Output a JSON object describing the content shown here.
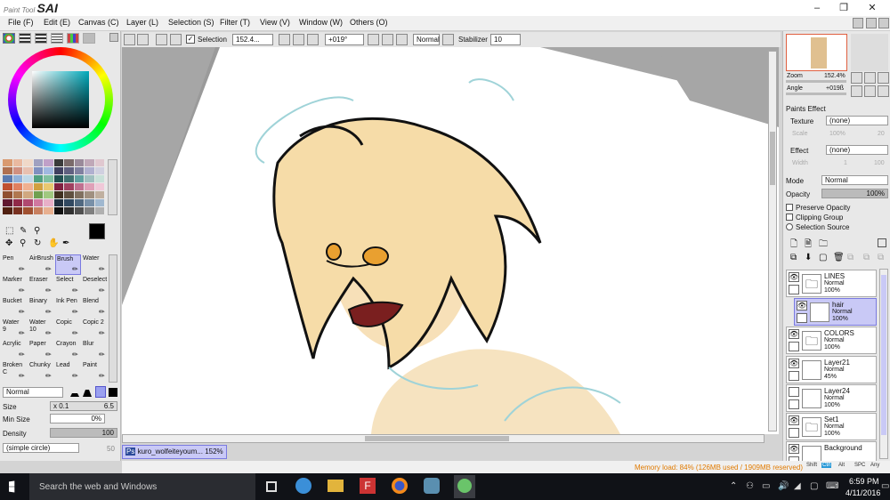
{
  "app": {
    "logo_small": "Paint Tool",
    "logo_big": "SAI"
  },
  "menu": [
    "File (F)",
    "Edit (E)",
    "Canvas (C)",
    "Layer (L)",
    "Selection (S)",
    "Filter (T)",
    "View (V)",
    "Window (W)",
    "Others (O)"
  ],
  "toolbar": {
    "selection_label": "Selection",
    "zoom": "152.4...",
    "angle": "+019°",
    "blend": "Normal",
    "stabilizer_label": "Stabilizer",
    "stabilizer": "10"
  },
  "tools": [
    [
      "Pen",
      "AirBrush",
      "Brush",
      "Water"
    ],
    [
      "Marker",
      "Eraser",
      "Select",
      "Deselect"
    ],
    [
      "Bucket",
      "Binary",
      "Ink Pen",
      "Blend"
    ],
    [
      "Water\n9",
      "Water\n10",
      "Copic",
      "Copic 2"
    ],
    [
      "Acrylic",
      "Paper",
      "Crayon",
      "Blur"
    ],
    [
      "Broken C",
      "Chunky",
      "Lead",
      "Paint"
    ]
  ],
  "brush": {
    "mode": "Normal",
    "size_label": "Size",
    "size_mult": "x 0.1",
    "size_val": "6.5",
    "minsize_label": "Min Size",
    "minsize_val": "0%",
    "density_label": "Density",
    "density_val": "100",
    "shape": "(simple circle)",
    "shape_val": "50"
  },
  "navigator": {
    "zoom_label": "Zoom",
    "zoom": "152.4%",
    "angle_label": "Angle",
    "angle": "+019ß"
  },
  "paints": {
    "title": "Paints Effect",
    "texture_label": "Texture",
    "texture": "(none)",
    "scale_label": "Scale",
    "scale": "100%",
    "scale_num": "20",
    "effect_label": "Effect",
    "effect": "(none)",
    "width_label": "Width",
    "width": "1",
    "width_num": "100"
  },
  "layerprops": {
    "mode_label": "Mode",
    "mode": "Normal",
    "opacity_label": "Opacity",
    "opacity": "100%",
    "preserve": "Preserve Opacity",
    "clipping": "Clipping Group",
    "source": "Selection Source"
  },
  "layers": [
    {
      "name": "LINES",
      "mode": "Normal",
      "opacity": "100%",
      "type": "folder",
      "visible": true,
      "selected": false
    },
    {
      "name": "hair",
      "mode": "Normal",
      "opacity": "100%",
      "type": "layer",
      "visible": true,
      "selected": true
    },
    {
      "name": "COLORS",
      "mode": "Normal",
      "opacity": "100%",
      "type": "folder",
      "visible": true,
      "selected": false
    },
    {
      "name": "Layer21",
      "mode": "Normal",
      "opacity": "45%",
      "type": "layer",
      "visible": true,
      "selected": false
    },
    {
      "name": "Layer24",
      "mode": "Normal",
      "opacity": "100%",
      "type": "layer",
      "visible": false,
      "selected": false
    },
    {
      "name": "Set1",
      "mode": "Normal",
      "opacity": "100%",
      "type": "folder",
      "visible": true,
      "selected": false
    },
    {
      "name": "Background",
      "mode": "",
      "opacity": "",
      "type": "layer",
      "visible": true,
      "selected": false
    }
  ],
  "status": {
    "doc_tab": "kuro_wolfeiteyoum...",
    "doc_zoom": "152%",
    "memory": "Memory load: 84% (126MB used / 1909MB reserved)",
    "keys": [
      "Shift",
      "Ctrl",
      "Alt",
      "SPC",
      "Any"
    ]
  },
  "taskbar": {
    "search": "Search the web and Windows",
    "time": "6:59 PM",
    "date": "4/11/2016"
  }
}
